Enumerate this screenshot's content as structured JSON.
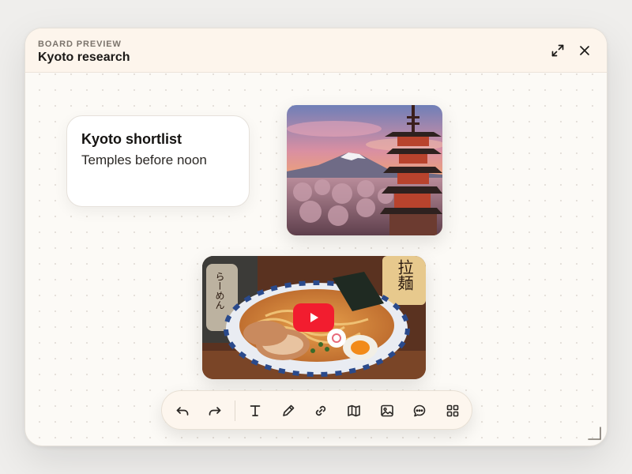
{
  "header": {
    "eyebrow": "BOARD PREVIEW",
    "title": "Kyoto research",
    "actions": [
      {
        "name": "expand",
        "icon": "expand-icon"
      },
      {
        "name": "close",
        "icon": "close-icon"
      }
    ]
  },
  "board": {
    "note": {
      "title": "Kyoto shortlist",
      "body": "Temples before noon"
    },
    "image_card": {
      "subject": "mountain-pagoda-cherry-blossom-photo"
    },
    "video_card": {
      "subject": "ramen-bowl-video-thumbnail",
      "play_icon": "play-icon",
      "play_color": "#f21d2f",
      "sign_text": "拉麺",
      "cup_text": "らーめん"
    }
  },
  "toolbar": {
    "tools": [
      {
        "name": "undo",
        "icon": "undo-icon"
      },
      {
        "name": "redo",
        "icon": "redo-icon"
      },
      {
        "name": "text",
        "icon": "text-cursor-icon"
      },
      {
        "name": "pen",
        "icon": "pencil-icon"
      },
      {
        "name": "link",
        "icon": "link-icon"
      },
      {
        "name": "map",
        "icon": "map-icon"
      },
      {
        "name": "image",
        "icon": "image-icon"
      },
      {
        "name": "comment",
        "icon": "comment-icon"
      },
      {
        "name": "apps",
        "icon": "grid-icon"
      }
    ]
  },
  "colors": {
    "header_bg": "#fdf5ec",
    "canvas_bg": "#fcfaf6",
    "text_primary": "#1c1a18",
    "text_muted": "#7b746c"
  }
}
